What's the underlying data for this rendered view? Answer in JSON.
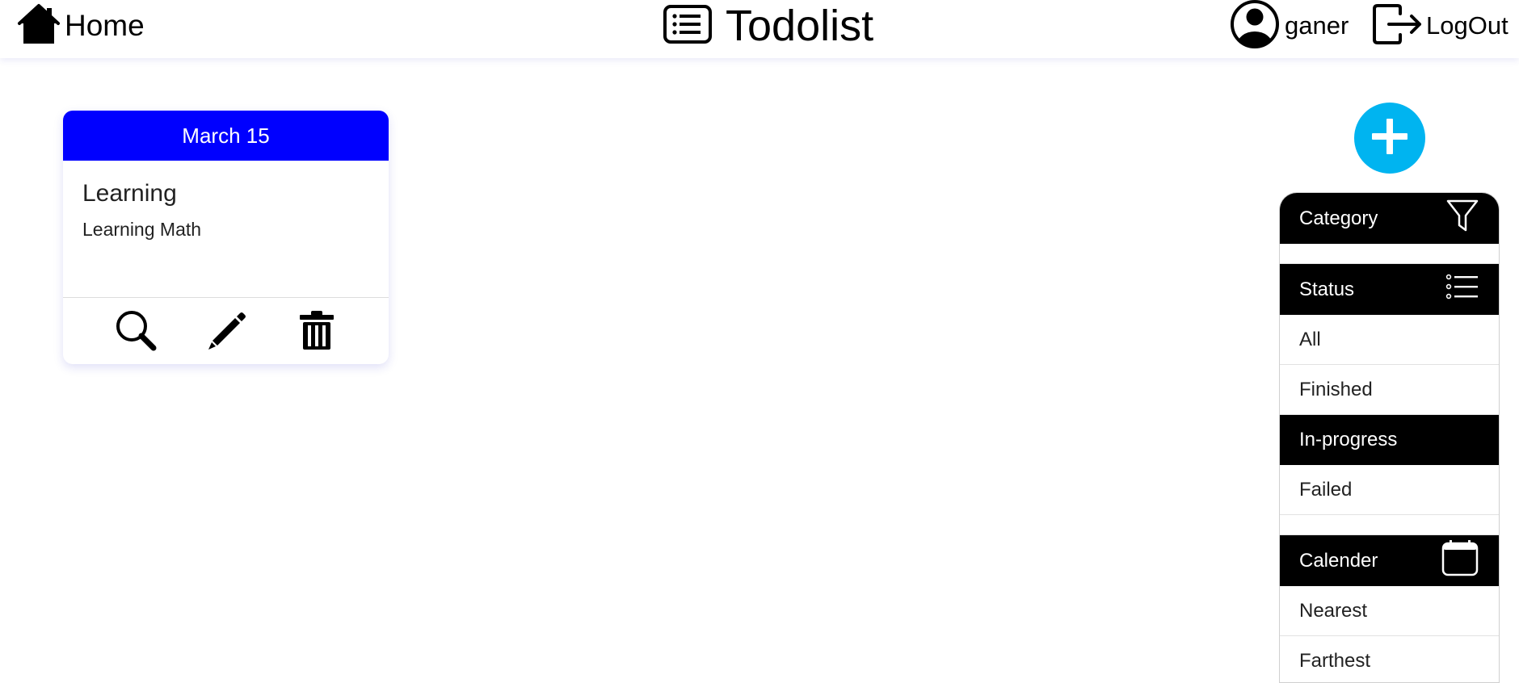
{
  "header": {
    "home_label": "Home",
    "app_title": "Todolist",
    "username": "ganer",
    "logout_label": "LogOut"
  },
  "task_card": {
    "date": "March 15",
    "title": "Learning",
    "description": "Learning Math",
    "header_color": "#0000ff",
    "actions": [
      "search-icon",
      "pencil-icon",
      "trash-icon"
    ]
  },
  "add_button": {
    "icon": "plus-icon",
    "color": "#00b4f0"
  },
  "sidebar": {
    "category": {
      "label": "Category",
      "icon": "funnel-icon"
    },
    "status": {
      "label": "Status",
      "icon": "list-icon",
      "options": [
        "All",
        "Finished",
        "In-progress",
        "Failed"
      ],
      "selected": "In-progress"
    },
    "calendar": {
      "label": "Calender",
      "icon": "calendar-icon",
      "options": [
        "Nearest",
        "Farthest"
      ]
    }
  }
}
